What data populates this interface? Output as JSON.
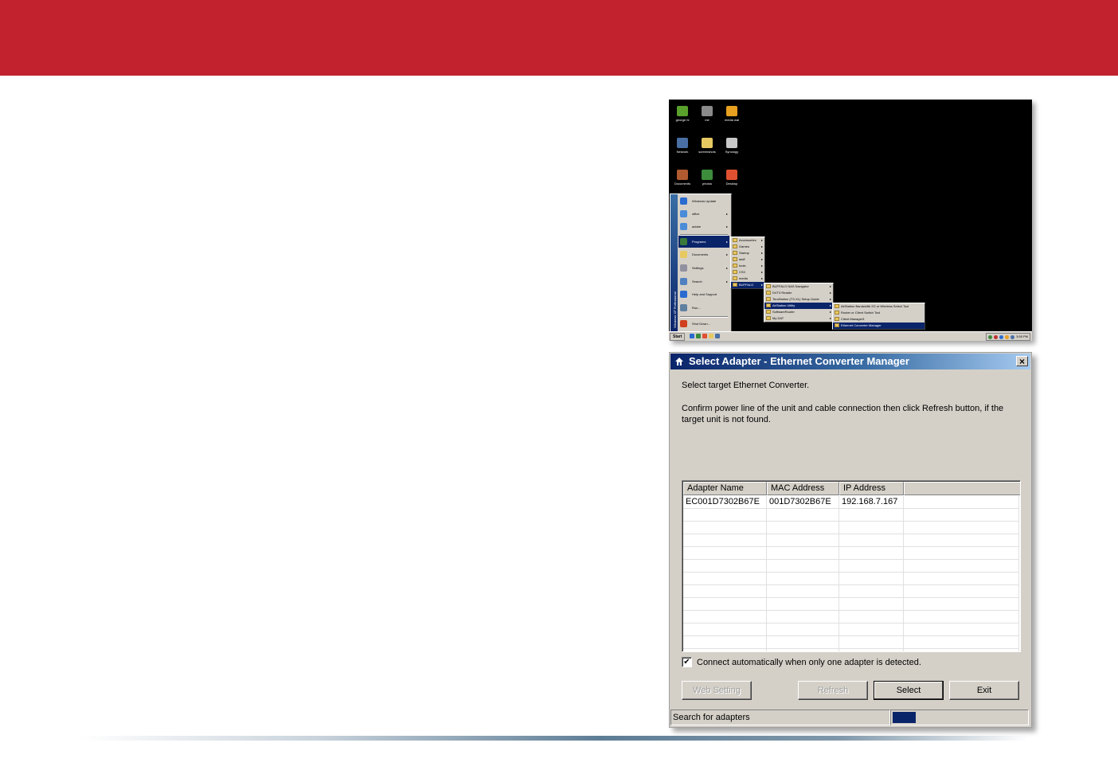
{
  "desktop": {
    "icons": [
      {
        "label": "george hi",
        "name": "green-app-icon",
        "color": "#5aa02c"
      },
      {
        "label": "me",
        "name": "camera-icon",
        "color": "#8a8a8a"
      },
      {
        "label": "media wal",
        "name": "media-icon",
        "color": "#e8a020"
      },
      {
        "label": "Network",
        "name": "network-icon",
        "color": "#4a6fa5"
      },
      {
        "label": "screenshots",
        "name": "folder-icon",
        "color": "#e8c860"
      },
      {
        "label": "Synology",
        "name": "server-icon",
        "color": "#c8c8c8"
      },
      {
        "label": "Documents",
        "name": "briefcase-icon",
        "color": "#b05a30"
      },
      {
        "label": "photos",
        "name": "photo-folder-icon",
        "color": "#3c8c3c"
      },
      {
        "label": "Desktop",
        "name": "swirl-icon",
        "color": "#e05030"
      }
    ],
    "start_menu": {
      "stripe": "Windows XP Professional",
      "items": [
        {
          "label": "Windows Update",
          "color": "#2a6bd0",
          "arrow": ""
        },
        {
          "label": "office",
          "color": "#4a8cd8",
          "arrow": "▸"
        },
        {
          "label": "adobe",
          "color": "#4a8cd8",
          "arrow": "▸"
        },
        {
          "label": "Programs",
          "color": "#3a7a3a",
          "arrow": "▸"
        },
        {
          "label": "Documents",
          "color": "#e8c860",
          "arrow": "▸"
        },
        {
          "label": "Settings",
          "color": "#9090a0",
          "arrow": "▸"
        },
        {
          "label": "Search",
          "color": "#5080c0",
          "arrow": "▸"
        },
        {
          "label": "Help and Support",
          "color": "#2a6bd0",
          "arrow": ""
        },
        {
          "label": "Run...",
          "color": "#6080a0",
          "arrow": ""
        },
        {
          "label": "Shut Down...",
          "color": "#d04020",
          "arrow": ""
        }
      ]
    },
    "programs_menu": [
      "Accessories",
      "Games",
      "Startup",
      "stuff",
      "tools",
      "CS3",
      "media",
      "BUFFALO"
    ],
    "buffalo_menu": [
      "BUFFALO NAS Navigator",
      "DVT3 Reader",
      "TeraStation (TS-XL) Setup Guide",
      "AirStation Utility",
      "SoftwareRouter",
      "My DAT"
    ],
    "airstation_menu": [
      "AirStation Bandwidth 2G or Wireless Select Tool",
      "Router or Client Switch Tool",
      "Client Manager3",
      "Ethernet Converter Manager"
    ],
    "taskbar": {
      "start": "Start",
      "clock": "3:55 PM"
    }
  },
  "dialog": {
    "title": "Select Adapter - Ethernet Converter Manager",
    "close": "×",
    "message1": "Select target Ethernet Converter.",
    "message2": "Confirm power line of the unit and cable connection then click Refresh button, if the target unit is not found.",
    "columns": [
      "Adapter Name",
      "MAC Address",
      "IP Address",
      ""
    ],
    "rows": [
      [
        "EC001D7302B67E",
        "001D7302B67E",
        "192.168.7.167",
        ""
      ]
    ],
    "checkbox": {
      "checked": true,
      "mark": "✔",
      "label": "Connect automatically when only one adapter is detected."
    },
    "buttons": {
      "web_setting": "Web Setting",
      "refresh": "Refresh",
      "select": "Select",
      "exit": "Exit"
    },
    "status": {
      "text": "Search for adapters",
      "progress": 0.17
    }
  }
}
